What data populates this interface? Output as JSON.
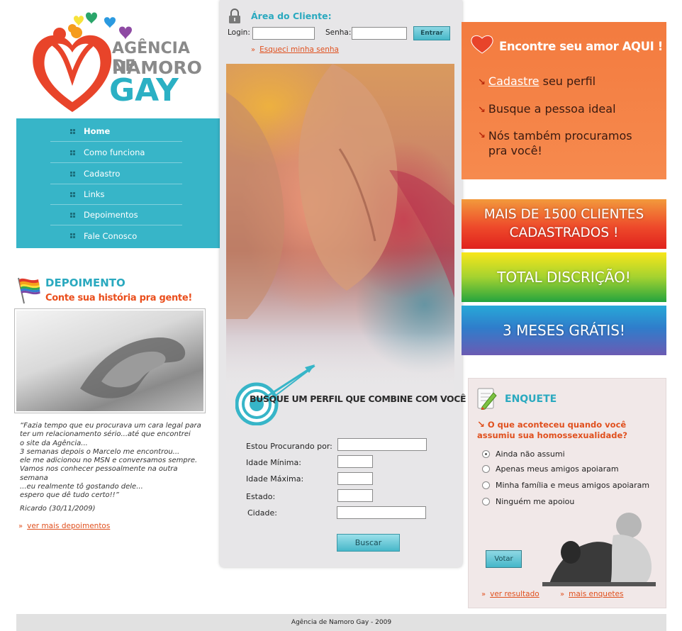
{
  "logo": {
    "line1": "AGÊNCIA DE",
    "line2": "NAMORO",
    "line3": "GAY",
    "heart_colors": [
      "#f7e23a",
      "#f59b1c",
      "#2aa56a",
      "#2b9ae0",
      "#8e4aa3"
    ]
  },
  "nav": {
    "items": [
      {
        "label": "Home"
      },
      {
        "label": "Como funciona"
      },
      {
        "label": "Cadastro"
      },
      {
        "label": "Links"
      },
      {
        "label": "Depoimentos"
      },
      {
        "label": "Fale Conosco"
      }
    ]
  },
  "depoimento": {
    "title": "DEPOIMENTO",
    "subtitle": "Conte sua história pra gente!",
    "quote": "“Fazia tempo que eu procurava um cara legal para\nter um relacionamento sério...até que encontrei\no site da Agência...\n3 semanas depois o Marcelo me encontrou...\nele me adicionou no MSN e conversamos sempre.\nVamos nos conhecer pessoalmente na outra semana\n...eu realmente tô gostando dele...\nespero que dê tudo certo!!”",
    "author": "Ricardo (30/11/2009)",
    "more_link": "ver mais depoimentos"
  },
  "login": {
    "title": "Área do Cliente:",
    "login_label": "Login:",
    "senha_label": "Senha:",
    "login_value": "",
    "senha_value": "",
    "submit_label": "Entrar",
    "forgot_link": "Esqueci minha senha"
  },
  "search": {
    "title": "BUSQUE UM PERFIL QUE COMBINE COM VOCÊ !",
    "fields": [
      {
        "label": "Estou Procurando por:",
        "value": ""
      },
      {
        "label": "Idade Mínima:",
        "value": ""
      },
      {
        "label": "Idade Máxima:",
        "value": ""
      },
      {
        "label": "Estado:",
        "value": ""
      },
      {
        "label": "Cidade:",
        "value": ""
      }
    ],
    "submit_label": "Buscar"
  },
  "promo": {
    "title": "Encontre seu amor AQUI !",
    "item1_link": "Cadastre",
    "item1_rest": " seu perfil",
    "item2": "Busque a pessoa ideal",
    "item3": "Nós também procuramos\npra você!"
  },
  "bands": {
    "band1": "MAIS DE 1500 CLIENTES\nCADASTRADOS !",
    "band2": "TOTAL DISCRIÇÃO!",
    "band3": "3 MESES GRÁTIS!"
  },
  "enquete": {
    "title": "ENQUETE",
    "question": "O que aconteceu quando você assumiu sua homossexualidade?",
    "options": [
      {
        "label": "Ainda não assumi",
        "selected": true
      },
      {
        "label": "Apenas meus amigos apoiaram",
        "selected": false
      },
      {
        "label": "Minha família e meus amigos apoiaram",
        "selected": false
      },
      {
        "label": "Ninguém me apoiou",
        "selected": false
      }
    ],
    "vote_label": "Votar",
    "result_link": "ver resultado",
    "more_link": "mais enquetes"
  },
  "footer": {
    "text": "Agência de Namoro Gay - 2009"
  },
  "colors": {
    "accent_teal": "#37b5c8",
    "accent_orange": "#e0501e",
    "promo_orange": "#f37b3f"
  }
}
